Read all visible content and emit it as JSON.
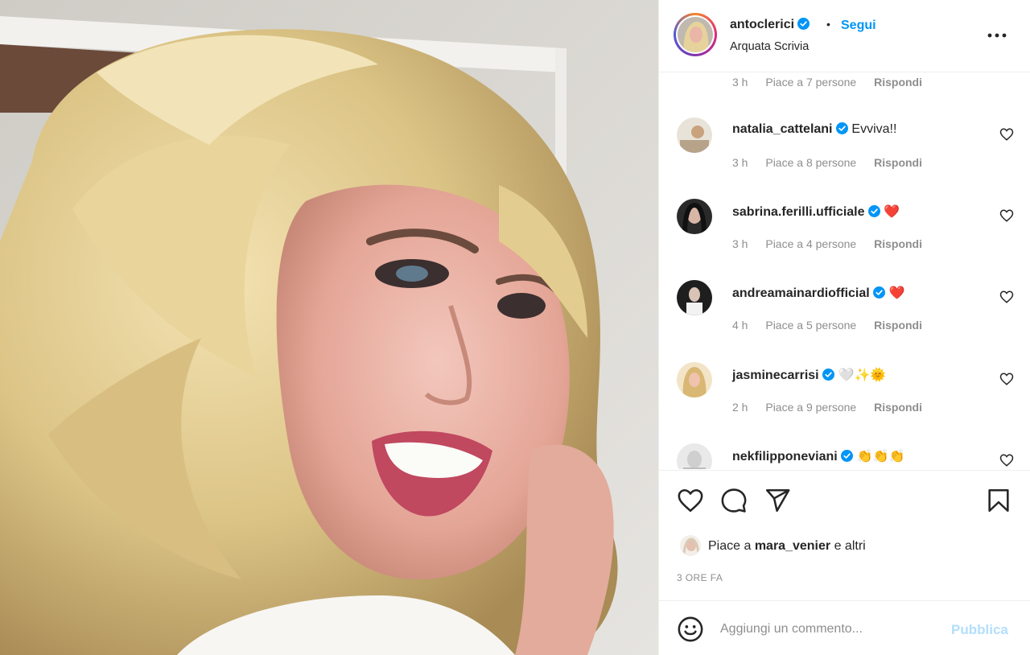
{
  "post": {
    "username": "antoclerici",
    "separator": "•",
    "follow_label": "Segui",
    "location": "Arquata Scrivia",
    "more_icon": "more-options-icon"
  },
  "top_meta": {
    "time": "3 h",
    "likes": "Piace a 7 persone",
    "reply": "Rispondi"
  },
  "comments": [
    {
      "user": "natalia_cattelani",
      "text": "Evviva!!",
      "emoji": "",
      "time": "3 h",
      "likes": "Piace a 8 persone",
      "reply": "Rispondi"
    },
    {
      "user": "sabrina.ferilli.ufficiale",
      "text": "",
      "emoji": "❤️",
      "time": "3 h",
      "likes": "Piace a 4 persone",
      "reply": "Rispondi"
    },
    {
      "user": "andreamainardiofficial",
      "text": "",
      "emoji": "❤️",
      "time": "4 h",
      "likes": "Piace a 5 persone",
      "reply": "Rispondi"
    },
    {
      "user": "jasminecarrisi",
      "text": "",
      "emoji": "🤍✨🌞",
      "time": "2 h",
      "likes": "Piace a 9 persone",
      "reply": "Rispondi"
    },
    {
      "user": "nekfilipponeviani",
      "text": "",
      "emoji": "👏👏👏",
      "time": "",
      "likes": "",
      "reply": ""
    }
  ],
  "actions": {
    "like_icon": "heart-icon",
    "comment_icon": "comment-icon",
    "share_icon": "share-icon",
    "save_icon": "bookmark-icon"
  },
  "likes": {
    "prefix": "Piace a",
    "user": "mara_venier",
    "suffix": "e altri"
  },
  "time_ago": "3 ORE FA",
  "add_comment": {
    "placeholder": "Aggiungi un commento...",
    "publish_label": "Pubblica"
  },
  "colors": {
    "accent": "#0095f6",
    "publish_disabled": "#b2dffc",
    "secondary_text": "#8e8e8e",
    "heart_red": "#e0245e"
  }
}
